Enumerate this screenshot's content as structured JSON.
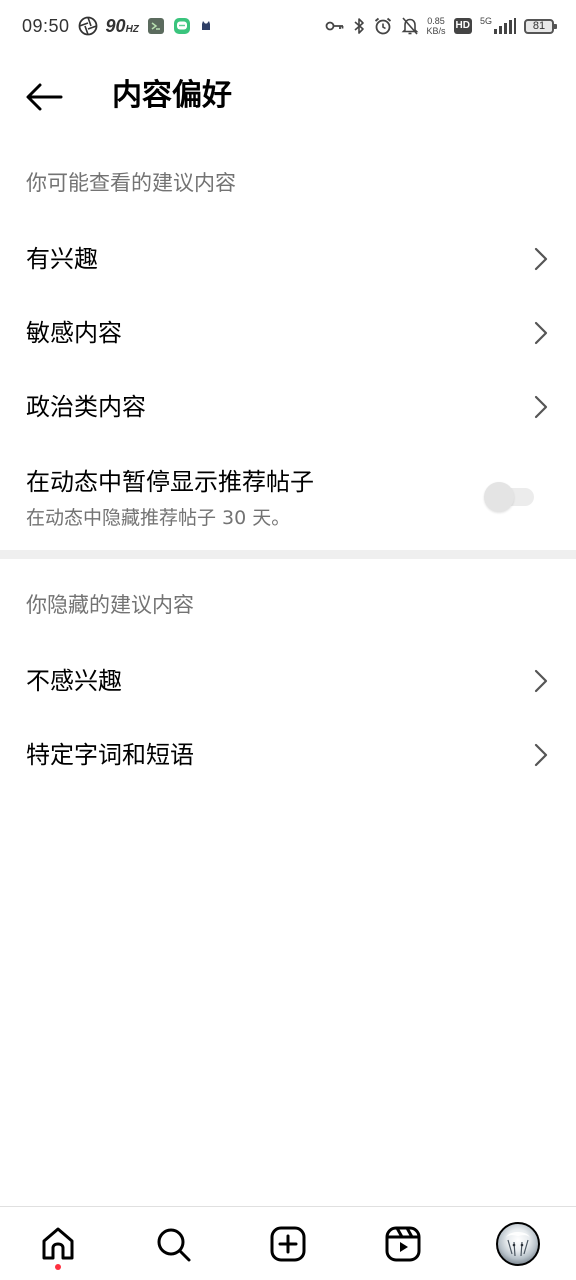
{
  "status_bar": {
    "time": "09:50",
    "refresh_rate": "90",
    "refresh_unit": "HZ",
    "net_speed_value": "0.85",
    "net_speed_unit": "KB/s",
    "hd_label": "HD",
    "network_type": "5G",
    "battery_level": "81"
  },
  "header": {
    "title": "内容偏好"
  },
  "section_suggested": {
    "heading": "你可能查看的建议内容",
    "items": [
      {
        "label": "有兴趣"
      },
      {
        "label": "敏感内容"
      },
      {
        "label": "政治类内容"
      }
    ],
    "toggle": {
      "title": "在动态中暂停显示推荐帖子",
      "subtitle": "在动态中隐藏推荐帖子 30 天。",
      "state": "off"
    }
  },
  "section_hidden": {
    "heading": "你隐藏的建议内容",
    "items": [
      {
        "label": "不感兴趣"
      },
      {
        "label": "特定字词和短语"
      }
    ]
  },
  "bottom_nav": {
    "items": [
      {
        "icon": "home-icon",
        "active": true
      },
      {
        "icon": "search-icon",
        "active": false
      },
      {
        "icon": "create-post-icon",
        "active": false
      },
      {
        "icon": "reels-icon",
        "active": false
      },
      {
        "icon": "profile-avatar",
        "active": false
      }
    ],
    "notification_dot_color": "#ff3040"
  }
}
